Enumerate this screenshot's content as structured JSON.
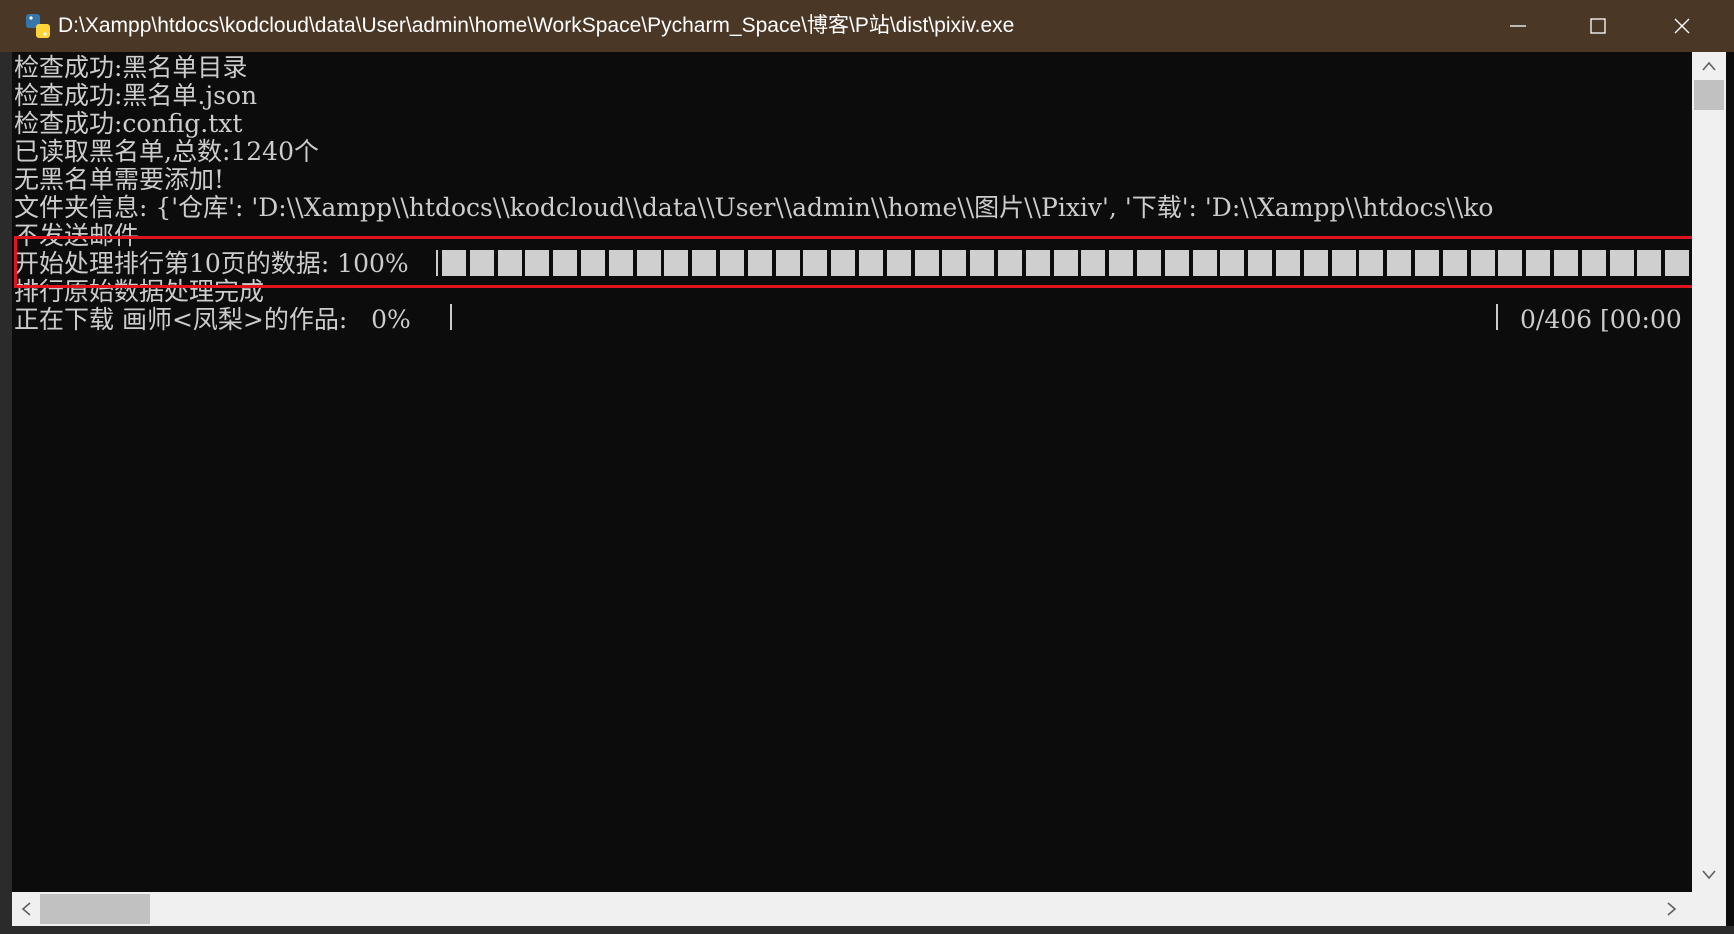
{
  "window": {
    "title": "D:\\Xampp\\htdocs\\kodcloud\\data\\User\\admin\\home\\WorkSpace\\Pycharm_Space\\博客\\P站\\dist\\pixiv.exe",
    "app_icon": "python-icon",
    "controls": {
      "minimize": "minimize-icon",
      "maximize": "maximize-icon",
      "close": "close-icon"
    }
  },
  "console": {
    "lines": [
      "检查成功:黑名单目录",
      "检查成功:黑名单.json",
      "检查成功:config.txt",
      "已读取黑名单,总数:1240个",
      "无黑名单需要添加!",
      "文件夹信息: {'仓库': 'D:\\\\Xampp\\\\htdocs\\\\kodcloud\\\\data\\\\User\\\\admin\\\\home\\\\图片\\\\Pixiv', '下载': 'D:\\\\Xampp\\\\htdocs\\\\ko",
      "不发送邮件",
      "开始处理排行第10页的数据: 100%",
      "排行原始数据处理完成",
      "正在下载 画师<凤梨>的作品:   0%"
    ],
    "download_status": "0/406 [00:00",
    "progress_processing": 1.0,
    "progress_download": 0.0
  },
  "colors": {
    "titlebar": "#4b3726",
    "console_bg": "#0c0c0c",
    "console_text": "#cccccc",
    "highlight": "#e0141e"
  }
}
